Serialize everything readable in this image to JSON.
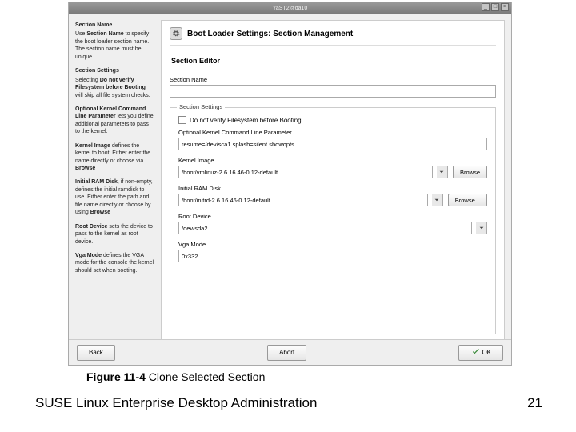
{
  "window": {
    "title": "YaST2@da10",
    "min": "_",
    "max": "□",
    "close": "×"
  },
  "sidebar": {
    "title1": "Section Name",
    "p1a": "Use ",
    "p1b": "Section Name",
    "p1c": " to specify the boot loader section name. The section name must be unique.",
    "title2": "Section Settings",
    "p2a": "Selecting ",
    "p2b": "Do not verify Filesystem before Booting",
    "p2c": " will skip all file system checks.",
    "p3a": "Optional Kernel Command Line Parameter",
    "p3b": " lets you define additional parameters to pass to the kernel.",
    "p4a": "Kernel Image",
    "p4b": " defines the kernel to boot. Either enter the name directly or choose via ",
    "p4c": "Browse",
    "p5a": "Initial RAM Disk",
    "p5b": ", if non-empty, defines the initial ramdisk to use. Either enter the path and file name directly or choose by using ",
    "p5c": "Browse",
    "p6a": "Root Device",
    "p6b": " sets the device to pass to the kernel as root device.",
    "p7a": "Vga Mode",
    "p7b": " defines the VGA mode for the console the kernel should set when booting."
  },
  "main": {
    "header": "Boot Loader Settings: Section Management",
    "section_editor": "Section Editor",
    "section_name_label": "Section Name",
    "section_name_value": "",
    "fieldset_legend": "Section Settings",
    "chk_label": "Do not verify Filesystem before Booting",
    "opt_kernel_label": "Optional Kernel Command Line Parameter",
    "opt_kernel_value": "resume=/dev/sca1 splash=silent showopts",
    "kernel_image_label": "Kernel Image",
    "kernel_image_value": "/boot/vmlinuz-2.6.16.46-0.12-default",
    "browse1": "Browse",
    "initrd_label": "Initial RAM Disk",
    "initrd_value": "/boot/initrd-2.6.16.46-0.12-default",
    "browse2": "Browse...",
    "root_label": "Root Device",
    "root_value": "/dev/sda2",
    "vga_label": "Vga Mode",
    "vga_value": "0x332"
  },
  "buttons": {
    "back": "Back",
    "abort": "Abort",
    "ok": "OK"
  },
  "caption": {
    "fig": "Figure 11-4",
    "text": " Clone Selected Section"
  },
  "footer": {
    "title": "SUSE Linux Enterprise Desktop Administration",
    "page": "21"
  }
}
